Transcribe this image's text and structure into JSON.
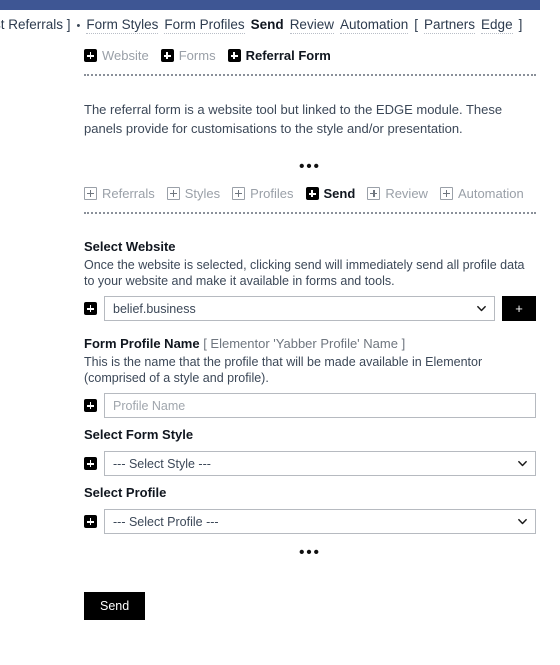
{
  "theme": {
    "admin_bar_color": "#3e5694",
    "accent_black": "#000000",
    "muted_text": "#9aa0a8",
    "body_text": "#3c4858"
  },
  "top_nav": {
    "leading_text": "st Referrals  ]",
    "bullet": "•",
    "items": [
      {
        "label": "Form Styles",
        "active": false
      },
      {
        "label": "Form Profiles",
        "active": false
      },
      {
        "label": "Send",
        "active": true
      },
      {
        "label": "Review",
        "active": false
      },
      {
        "label": "Automation",
        "active": false
      }
    ],
    "bracket_open": "[",
    "trailing_items": [
      {
        "label": "Partners",
        "active": false
      },
      {
        "label": "Edge",
        "active": false
      }
    ],
    "bracket_close": "]"
  },
  "breadcrumb_chips": [
    {
      "label": "Website",
      "active": false
    },
    {
      "label": "Forms",
      "active": false
    },
    {
      "label": "Referral Form",
      "active": true
    }
  ],
  "intro_paragraph": "The referral form is a website tool but linked to the EDGE module. These panels provide for customisations to the style and/or presentation.",
  "dots_divider": "•••",
  "module_chips": [
    {
      "label": "Referrals",
      "active": false
    },
    {
      "label": "Styles",
      "active": false
    },
    {
      "label": "Profiles",
      "active": false
    },
    {
      "label": "Send",
      "active": true
    },
    {
      "label": "Review",
      "active": false
    },
    {
      "label": "Automation",
      "active": false
    }
  ],
  "fields": {
    "website": {
      "title": "Select Website",
      "description": "Once the website is selected, clicking send will immediately send all profile data to your website and make it available in forms and tools.",
      "selected_value": "belief.business",
      "add_button_label": "+"
    },
    "profile_name": {
      "title": "Form Profile Name",
      "title_suffix": " [ Elementor 'Yabber Profile' Name ]",
      "description": "This is the name that the profile that will be made available in Elementor (comprised of a style and profile).",
      "value": "",
      "placeholder": "Profile Name"
    },
    "form_style": {
      "title": "Select Form Style",
      "selected_value": "--- Select Style ---"
    },
    "profile": {
      "title": "Select Profile",
      "selected_value": "--- Select Profile ---"
    }
  },
  "submit": {
    "label": "Send"
  }
}
